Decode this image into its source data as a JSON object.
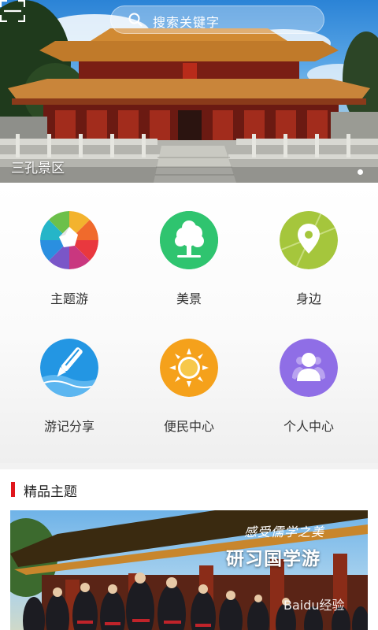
{
  "search": {
    "placeholder": "搜索关键字"
  },
  "banner": {
    "caption": "三孔景区"
  },
  "menu": [
    {
      "label": "主题游",
      "icon": "pinwheel-icon",
      "color": "#f3b32e"
    },
    {
      "label": "美景",
      "icon": "tree-icon",
      "color": "#2fc46f"
    },
    {
      "label": "身边",
      "icon": "location-pin-icon",
      "color": "#a5c63c"
    },
    {
      "label": "游记分享",
      "icon": "pen-icon",
      "color": "#2396e3"
    },
    {
      "label": "便民中心",
      "icon": "sun-icon",
      "color": "#f5a11b"
    },
    {
      "label": "个人中心",
      "icon": "user-icon",
      "color": "#8f6ee6"
    }
  ],
  "featured": {
    "section_title": "精品主题",
    "banner_subtitle": "感受儒学之美",
    "banner_title": "研习国学游"
  },
  "watermark": "Baidu经验",
  "colors": {
    "accent": "#e0161c"
  }
}
